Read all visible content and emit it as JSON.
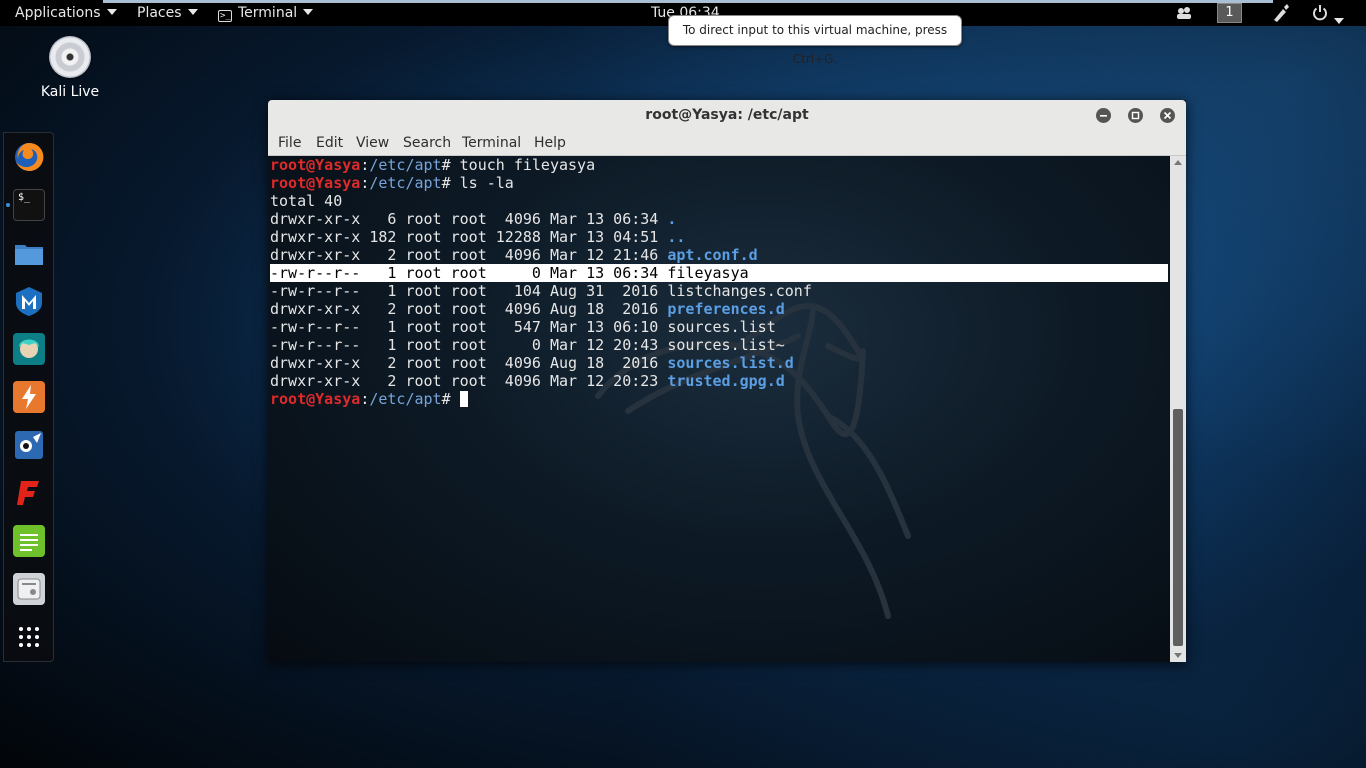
{
  "topbar": {
    "applications_label": "Applications",
    "places_label": "Places",
    "terminal_label": "Terminal",
    "clock": "Tue 06:34",
    "workspace_number": "1"
  },
  "tooltip": "To direct input to this virtual machine, press Ctrl+G.",
  "desktop": {
    "icon_label": "Kali Live"
  },
  "dock": {
    "items": [
      "firefox-icon",
      "terminal-icon",
      "files-icon",
      "metasploit-icon",
      "armitage-icon",
      "burpsuite-icon",
      "maltego-icon",
      "faraday-icon",
      "leafpad-icon",
      "cherrytree-icon",
      "show-apps-icon"
    ]
  },
  "window": {
    "title": "root@Yasya: /etc/apt",
    "menu": [
      "File",
      "Edit",
      "View",
      "Search",
      "Terminal",
      "Help"
    ]
  },
  "terminal": {
    "user_host": "root@Yasya",
    "path_sep": ":",
    "path": "/etc/apt",
    "prompt_char": "#",
    "cmd1": " touch fileyasya",
    "cmd2": " ls -la",
    "total": "total 40",
    "rows": [
      {
        "meta": "drwxr-xr-x   6 root root  4096 Mar 13 06:34 ",
        "name": "."
      },
      {
        "meta": "drwxr-xr-x 182 root root 12288 Mar 13 04:51 ",
        "name": ".."
      },
      {
        "meta": "drwxr-xr-x   2 root root  4096 Mar 12 21:46 ",
        "name": "apt.conf.d"
      },
      {
        "meta": "-rw-r--r--   1 root root     0 Mar 13 06:34 ",
        "name": "fileyasya"
      },
      {
        "meta": "-rw-r--r--   1 root root   104 Aug 31  2016 ",
        "name": "listchanges.conf"
      },
      {
        "meta": "drwxr-xr-x   2 root root  4096 Aug 18  2016 ",
        "name": "preferences.d"
      },
      {
        "meta": "-rw-r--r--   1 root root   547 Mar 13 06:10 ",
        "name": "sources.list"
      },
      {
        "meta": "-rw-r--r--   1 root root     0 Mar 12 20:43 ",
        "name": "sources.list~"
      },
      {
        "meta": "drwxr-xr-x   2 root root  4096 Aug 18  2016 ",
        "name": "sources.list.d"
      },
      {
        "meta": "drwxr-xr-x   2 root root  4096 Mar 12 20:23 ",
        "name": "trusted.gpg.d"
      }
    ]
  },
  "colors": {
    "prompt_user": "#e02a2a",
    "prompt_path": "#76a4d8",
    "dir": "#5b9ee3",
    "topbar": "#000000"
  }
}
